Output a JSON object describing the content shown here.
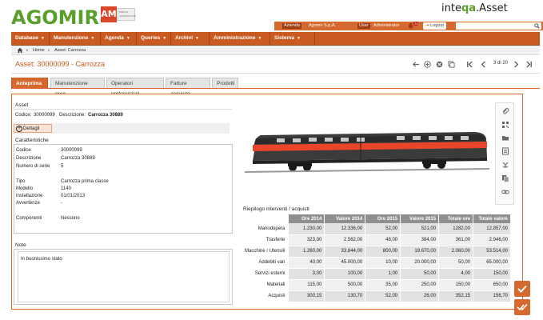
{
  "brand": {
    "logo_text": "AGOMIR",
    "am_badge": "AM",
    "am_sub": "SIMPLE CONTRACTOR",
    "product_prefix": "inte",
    "product_mark": "q",
    "product_mark2": "a",
    "product_suffix": ".Asset"
  },
  "infobar": {
    "company_label": "Azienda",
    "company_value": "Agomir S.p.A.",
    "user_label": "User",
    "user_value": "Administrator",
    "notifications": "71",
    "logout_label": "Logout",
    "search_placeholder": ""
  },
  "menu": [
    {
      "label": "Database"
    },
    {
      "label": "Manutenzione"
    },
    {
      "label": "Agenda"
    },
    {
      "label": "Queries"
    },
    {
      "label": "Archivi"
    },
    {
      "label": "Amministrazione"
    },
    {
      "label": "Sistema"
    }
  ],
  "breadcrumb": {
    "home": "Home",
    "current": "Asset: Carrozza"
  },
  "page": {
    "title": "Asset: 30000099 - Carrozza",
    "pager": "3 di 20"
  },
  "tabs": [
    {
      "label": "Anteprima",
      "active": true
    },
    {
      "label": "Manutenzione prog."
    },
    {
      "label": "Operatori preferenziali"
    },
    {
      "label": "Fatture acquisto"
    },
    {
      "label": "Prodotti"
    }
  ],
  "asset": {
    "section": "Asset",
    "codice_label": "Codice:",
    "codice_value": "30000099",
    "descrizione_label": "Descrizione:",
    "descrizione_value": "Carrozza 30889",
    "details_button": "Dettagli"
  },
  "caratteristiche": {
    "section": "Caratteristiche",
    "rows": [
      {
        "label": "Codice",
        "value": "30000099"
      },
      {
        "label": "Descrizione",
        "value": "Carrozza 30889"
      },
      {
        "label": "Numero di serie",
        "value": "5"
      },
      {
        "label": "Tipo",
        "value": "Carrozza prima classe"
      },
      {
        "label": "Modello",
        "value": "1140"
      },
      {
        "label": "Installazione",
        "value": "01/01/2013"
      },
      {
        "label": "Avvertenze",
        "value": "-"
      },
      {
        "label": "Componenti",
        "value": "Nessuno"
      }
    ]
  },
  "note": {
    "section": "Note",
    "text": "In buonissimo stato"
  },
  "riepilogo": {
    "title": "Riepilogo interventi / acquisti",
    "headers": [
      "Ore 2014",
      "Valore 2014",
      "Ore 2015",
      "Valore 2015",
      "Totale ore",
      "Totale valore"
    ],
    "rows": [
      {
        "label": "Manodopera",
        "values": [
          "1.230,00",
          "12.336,00",
          "52,00",
          "521,00",
          "1282,00",
          "12.857,00"
        ]
      },
      {
        "label": "Trasferte",
        "values": [
          "323,00",
          "2.562,00",
          "48,00",
          "384,00",
          "361,00",
          "2.946,00"
        ]
      },
      {
        "label": "Macchine / Utensili",
        "values": [
          "1.260,00",
          "33.844,00",
          "800,00",
          "19.670,00",
          "2.060,00",
          "53.514,00"
        ]
      },
      {
        "label": "Addebiti vari",
        "values": [
          "40,00",
          "45.000,00",
          "10,00",
          "20.000,00",
          "50,00",
          "65.000,00"
        ]
      },
      {
        "label": "Servizi esterni",
        "values": [
          "3,00",
          "100,00",
          "1,00",
          "50,00",
          "4,00",
          "150,00"
        ]
      },
      {
        "label": "Materiali",
        "values": [
          "115,00",
          "500,00",
          "35,00",
          "250,00",
          "150,00",
          "650,00"
        ]
      },
      {
        "label": "Acquisti",
        "values": [
          "300,15",
          "130,70",
          "52,00",
          "26,00",
          "352,15",
          "156,70"
        ]
      }
    ]
  },
  "colors": {
    "accent": "#d6692e",
    "brand_green": "#5a9e2c",
    "menu": "#c95a22"
  }
}
